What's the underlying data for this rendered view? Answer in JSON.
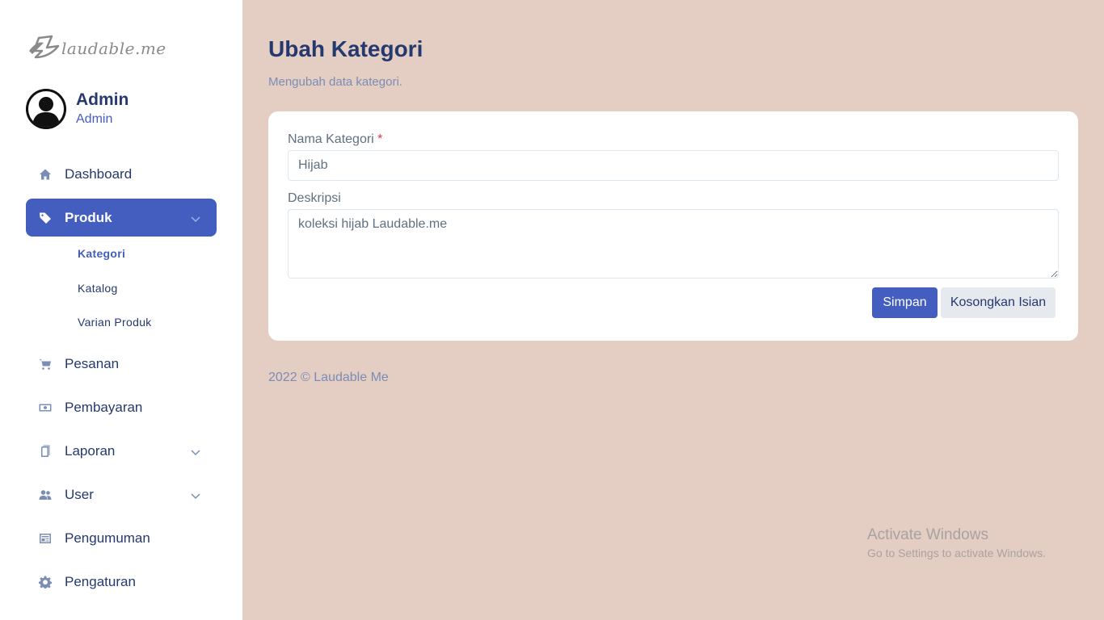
{
  "sidebar": {
    "logo_text": "laudable.me",
    "profile": {
      "name": "Admin",
      "role": "Admin"
    },
    "menu": [
      {
        "label": "Dashboard",
        "icon": "home-icon"
      },
      {
        "label": "Produk",
        "icon": "tag-icon",
        "active": true,
        "expanded": true
      },
      {
        "label": "Pesanan",
        "icon": "cart-icon"
      },
      {
        "label": "Pembayaran",
        "icon": "cash-icon"
      },
      {
        "label": "Laporan",
        "icon": "files-icon",
        "has_submenu": true
      },
      {
        "label": "User",
        "icon": "users-icon",
        "has_submenu": true
      },
      {
        "label": "Pengumuman",
        "icon": "newspaper-icon"
      },
      {
        "label": "Pengaturan",
        "icon": "gear-icon"
      }
    ],
    "produk_submenu": [
      {
        "label": "Kategori",
        "active": true
      },
      {
        "label": "Katalog"
      },
      {
        "label": "Varian Produk"
      }
    ]
  },
  "page": {
    "title": "Ubah Kategori",
    "subtitle": "Mengubah data kategori."
  },
  "form": {
    "nama_label": "Nama Kategori",
    "required_mark": "*",
    "nama_value": "Hijab",
    "deskripsi_label": "Deskripsi",
    "deskripsi_value": "koleksi hijab Laudable.me",
    "submit_label": "Simpan",
    "reset_label": "Kosongkan Isian"
  },
  "footer": {
    "text": "2022 © Laudable Me"
  },
  "watermark": {
    "title": "Activate Windows",
    "subtitle": "Go to Settings to activate Windows."
  },
  "colors": {
    "background": "#e4cdc2",
    "primary": "#435ebe",
    "heading": "#25396f",
    "muted": "#7c8db5"
  }
}
